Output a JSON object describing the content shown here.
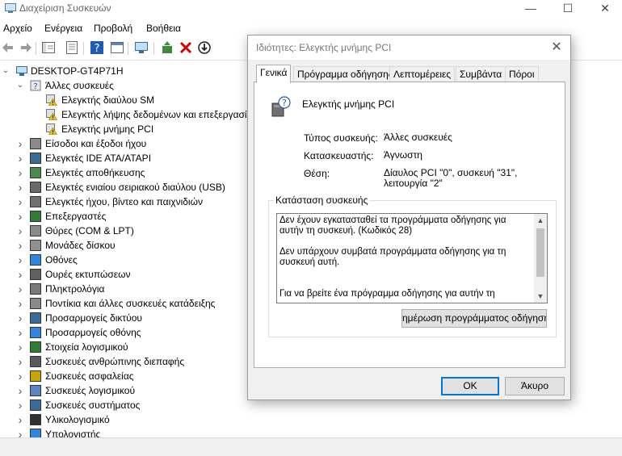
{
  "window": {
    "title": "Διαχείριση Συσκευών",
    "icon": "device-manager-icon",
    "controls": [
      "—",
      "☐",
      "✕"
    ]
  },
  "menu": [
    "Αρχείο",
    "Ενέργεια",
    "Προβολή",
    "Βοήθεια"
  ],
  "toolbar": {
    "icons": [
      "back-arrow-icon",
      "forward-arrow-icon",
      "show-hide-tree-icon",
      "properties-icon",
      "help-icon",
      "view-icon",
      "monitor-icon",
      "update-driver-icon",
      "uninstall-x-icon",
      "disable-device-icon"
    ]
  },
  "tree": {
    "root": "DESKTOP-GT4P71H",
    "other_devices": {
      "label": "Άλλες συσκευές",
      "children": [
        "Ελεγκτής διαύλου SM",
        "Ελεγκτής λήψης δεδομένων και επεξεργασί",
        "Ελεγκτής μνήμης PCI"
      ]
    },
    "categories": [
      "Είσοδοι και έξοδοι ήχου",
      "Ελεγκτές IDE ATA/ATAPI",
      "Ελεγκτές αποθήκευσης",
      "Ελεγκτές ενιαίου σειριακού διαύλου (USB)",
      "Ελεγκτές ήχου, βίντεο και παιχνιδιών",
      "Επεξεργαστές",
      "Θύρες (COM & LPT)",
      "Μονάδες δίσκου",
      "Οθόνες",
      "Ουρές εκτυπώσεων",
      "Πληκτρολόγια",
      "Ποντίκια και άλλες συσκευές κατάδειξης",
      "Προσαρμογείς δικτύου",
      "Προσαρμογείς οθόνης",
      "Στοιχεία λογισμικού",
      "Συσκευές ανθρώπινης διεπαφής",
      "Συσκευές ασφαλείας",
      "Συσκευές λογισμικού",
      "Συσκευές συστήματος",
      "Υλικολογισμικό",
      "Υπολογιστής"
    ]
  },
  "dialog": {
    "title": "Ιδιότητες: Ελεγκτής μνήμης PCI",
    "close": "✕",
    "tabs": [
      "Γενικά",
      "Πρόγραμμα οδήγησης",
      "Λεπτομέρειες",
      "Συμβάντα",
      "Πόροι"
    ],
    "device_name": "Ελεγκτής μνήμης PCI",
    "properties": [
      {
        "label": "Τύπος συσκευής:",
        "value": "Άλλες συσκευές"
      },
      {
        "label": "Κατασκευαστής:",
        "value": "Άγνωστη"
      },
      {
        "label": "Θέση:",
        "value": "Δίαυλος PCI \"0\", συσκευή \"31\", λειτουργία \"2\""
      }
    ],
    "status_group": "Κατάσταση συσκευής",
    "status_text": "Δεν έχουν εγκατασταθεί τα προγράμματα οδήγησης για αυτήν τη συσκευή. (Κωδικός 28)\n\nΔεν υπάρχουν συμβατά προγράμματα οδήγησης για τη συσκευή αυτή.\n\n\nΓια να βρείτε ένα πρόγραμμα οδήγησης για αυτήν τη",
    "update_button": "ημέρωση προγράμματος οδήγησης",
    "ok": "OK",
    "cancel": "Άκυρο"
  }
}
